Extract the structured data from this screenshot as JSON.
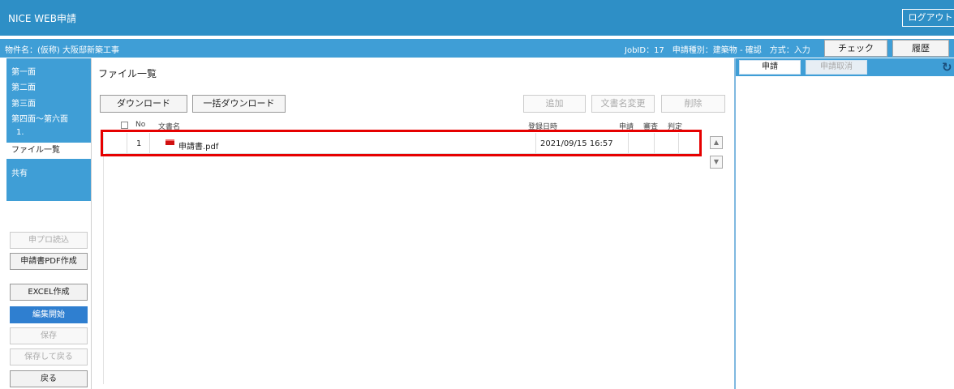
{
  "header": {
    "app_title": "NICE WEB申請",
    "logout_label": "ログアウト"
  },
  "subbar": {
    "project_name": "物件名：(仮称) 大阪邸新築工事",
    "job_info": "JobID：17　申請種別：建築物 - 確認　方式：入力",
    "check_label": "チェック",
    "history_label": "履歴"
  },
  "sidebar": {
    "nav": [
      "第一面",
      "第二面",
      "第三面",
      "第四面～第六面",
      "1.",
      "ファイル一覧",
      "共有"
    ],
    "active_index": 5,
    "buttons": {
      "shinpuro": "申プロ読込",
      "pdf": "申請書PDF作成",
      "excel": "EXCEL作成",
      "edit": "編集開始",
      "save": "保存",
      "save_return": "保存して戻る",
      "back": "戻る"
    }
  },
  "main": {
    "title": "ファイル一覧",
    "toolbar": {
      "download": "ダウンロード",
      "bulk_download": "一括ダウンロード",
      "add": "追加",
      "rename": "文書名変更",
      "delete": "削除"
    },
    "columns": {
      "no": "No",
      "name": "文書名",
      "date": "登録日時",
      "apply": "申請",
      "review": "審査",
      "judge": "判定"
    },
    "rows": [
      {
        "no": "1",
        "name": "申請書.pdf",
        "date": "2021/09/15 16:57"
      }
    ]
  },
  "right_panel": {
    "tab_apply": "申請",
    "tab_cancel": "申請取消"
  },
  "icons": {
    "refresh": "refresh-icon",
    "pdf": "pdf-file-icon",
    "scroll_up": "chevron-up-icon",
    "scroll_down": "chevron-down-icon"
  },
  "colors": {
    "header": "#2e8fc6",
    "subbar": "#3f9ed6",
    "highlight": "#e60000",
    "primary_button": "#2f7fd0"
  }
}
